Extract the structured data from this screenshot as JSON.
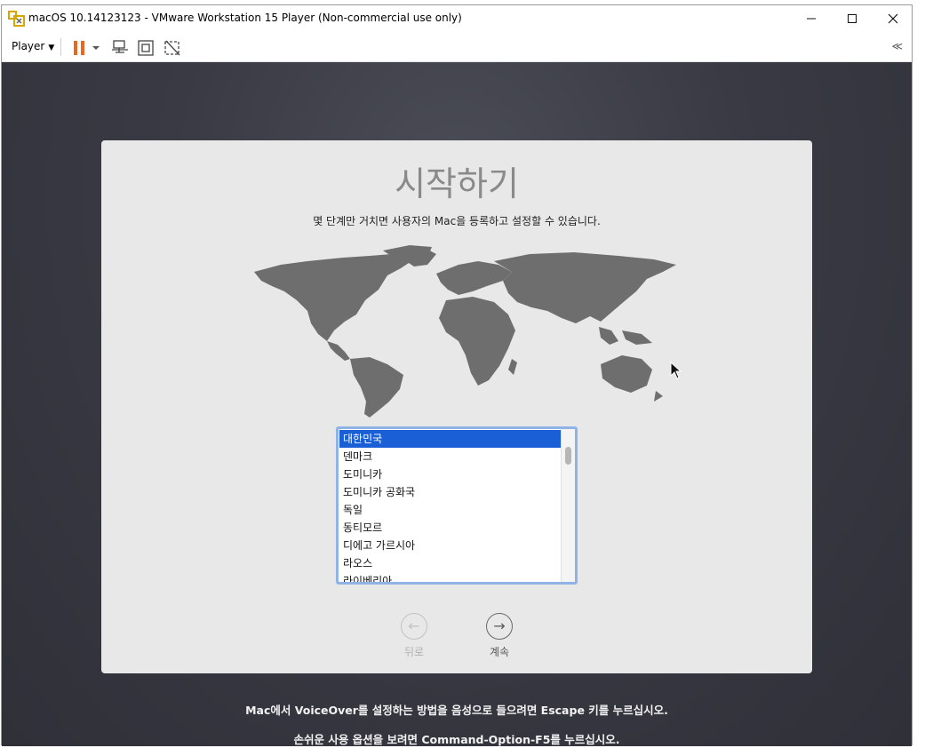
{
  "window": {
    "title": "macOS 10.14123123 - VMware Workstation 15 Player (Non-commercial use only)",
    "minimize_icon": "minimize-icon",
    "maximize_icon": "maximize-icon",
    "close_icon": "close-icon"
  },
  "toolbar": {
    "player_label": "Player",
    "icons": [
      "pause-icon",
      "dropdown-caret-icon",
      "send-ctrl-alt-del-icon",
      "fullscreen-icon",
      "unity-icon",
      "collapse-icon"
    ],
    "pause_color": "#e8681f"
  },
  "setup": {
    "title": "시작하기",
    "subtitle": "몇 단계만 거치면 사용자의 Mac을 등록하고 설정할 수 있습니다.",
    "countries": [
      "대한민국",
      "덴마크",
      "도미니카",
      "도미니카 공화국",
      "독일",
      "동티모르",
      "디에고 가르시아",
      "라오스",
      "라이베리아"
    ],
    "selected_country": "대한민국",
    "back_label": "뒤로",
    "continue_label": "계속",
    "selection_color": "#1a5fd6"
  },
  "hints": {
    "voiceover": "Mac에서 VoiceOver를 설정하는 방법을 음성으로 들으려면 Escape 키를 누르십시오.",
    "accessibility": "손쉬운 사용 옵션을 보려면 Command-Option-F5를 누르십시오."
  }
}
